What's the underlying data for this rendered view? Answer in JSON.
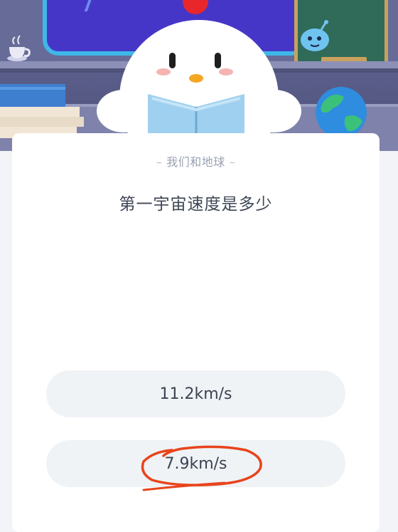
{
  "quiz": {
    "category": "我们和地球",
    "question": "第一宇宙速度是多少",
    "options": [
      {
        "label": "11.2km/s"
      },
      {
        "label": "7.9km/s",
        "circled": true
      }
    ]
  },
  "colors": {
    "annotation_stroke": "#e8441c",
    "option_bg": "#f0f3f6",
    "card_bg": "#ffffff"
  },
  "icons": [
    "chick-mascot",
    "globe-icon",
    "books-icon",
    "cup-icon",
    "blue-alien-mascot",
    "chalkboard"
  ]
}
